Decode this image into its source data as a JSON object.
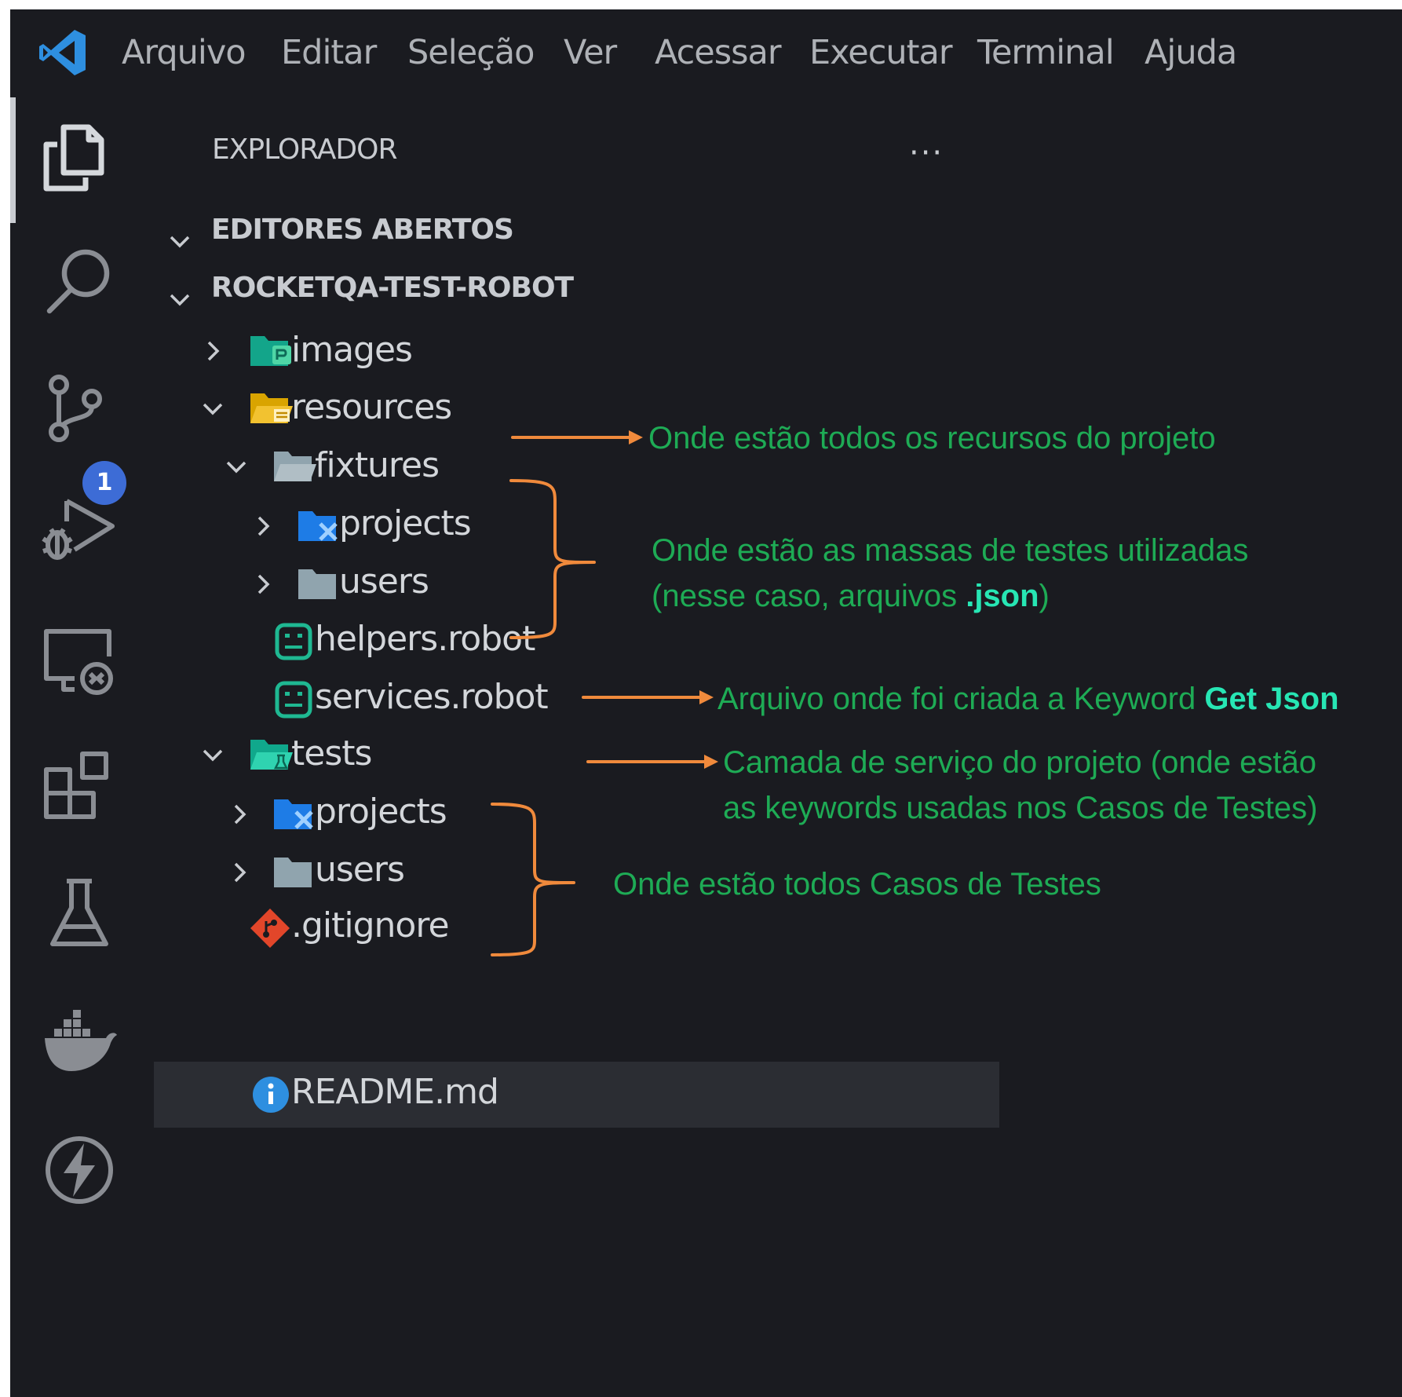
{
  "menu": {
    "items": [
      "Arquivo",
      "Editar",
      "Seleção",
      "Ver",
      "Acessar",
      "Executar",
      "Terminal",
      "Ajuda"
    ]
  },
  "activity_bar": {
    "icons": [
      "explorer-icon",
      "search-icon",
      "source-control-icon",
      "run-debug-icon",
      "remote-explorer-icon",
      "extensions-icon",
      "testing-icon",
      "docker-icon",
      "thunder-client-icon"
    ],
    "source_control_badge": "1"
  },
  "explorer": {
    "title": "EXPLORADOR",
    "more": "···",
    "open_editors": "EDITORES ABERTOS",
    "workspace": "ROCKETQA-TEST-ROBOT",
    "tree": {
      "images": "images",
      "resources": "resources",
      "fixtures": "fixtures",
      "fixtures_projects": "projects",
      "fixtures_users": "users",
      "helpers": "helpers.robot",
      "services": "services.robot",
      "tests": "tests",
      "tests_projects": "projects",
      "tests_users": "users",
      "gitignore": ".gitignore",
      "readme": "README.md"
    }
  },
  "annotations": {
    "resources": "Onde estão todos os recursos do projeto",
    "fixtures_line1": "Onde estão as massas de testes utilizadas",
    "fixtures_line2_prefix": "(nesse caso, arquivos ",
    "fixtures_line2_bold": ".json",
    "fixtures_line2_suffix": ")",
    "helpers_prefix": "Arquivo onde foi criada a Keyword ",
    "helpers_bold": "Get Json",
    "services_line1": "Camada de serviço do projeto (onde estão",
    "services_line2": "as keywords usadas nos Casos de Testes)",
    "tests": "Onde estão todos Casos de Testes"
  },
  "colors": {
    "background": "#1a1b20",
    "selection": "#2b2d33",
    "annotation_text": "#1eab55",
    "annotation_bold": "#27e6b4",
    "annotation_arrow": "#f08a3c",
    "vscode_blue": "#2e8fe0",
    "badge": "#3d6cd6"
  }
}
